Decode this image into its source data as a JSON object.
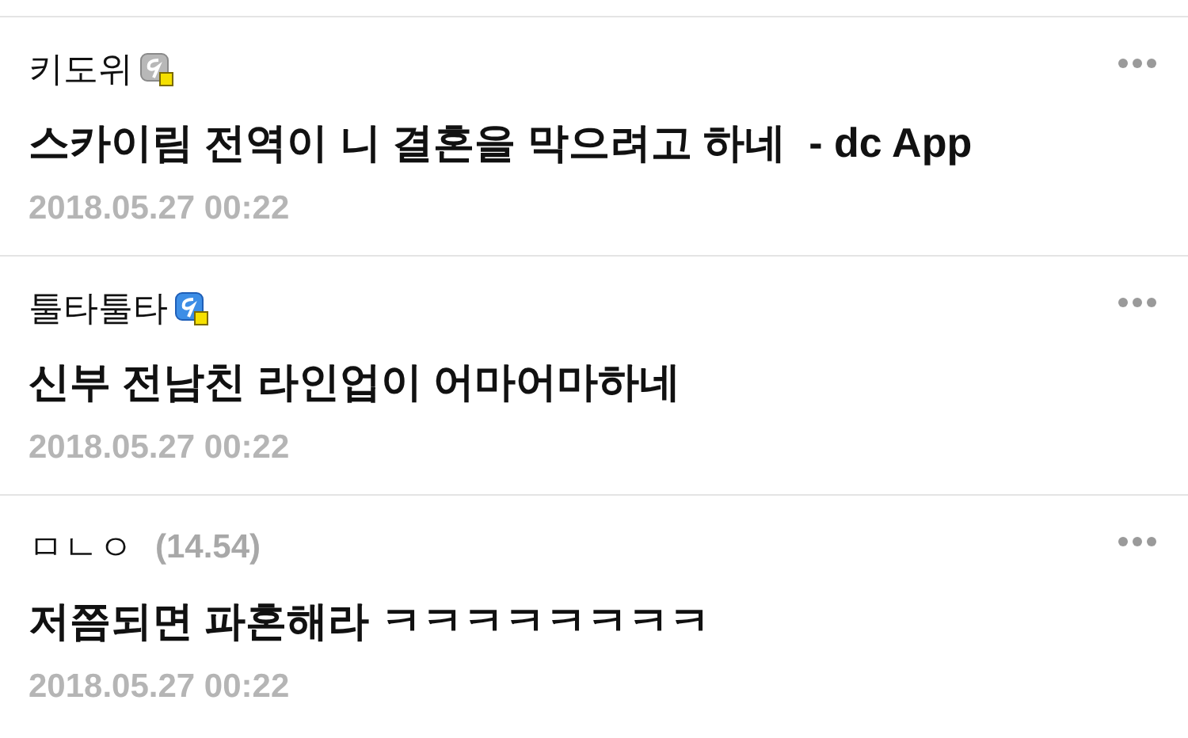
{
  "comments": [
    {
      "author": "키도위",
      "badge": {
        "kind": "gray"
      },
      "text": "스카이림 전역이 니 결혼을 막으려고 하네  - dc App",
      "date": "2018.05.27 00:22"
    },
    {
      "author": "툴타툴타",
      "badge": {
        "kind": "blue"
      },
      "text": "신부 전남친 라인업이 어마어마하네",
      "date": "2018.05.27 00:22"
    },
    {
      "author": "ㅁㄴㅇ",
      "ip": "(14.54)",
      "text": "저쯤되면 파혼해라 ㅋㅋㅋㅋㅋㅋㅋㅋ",
      "date": "2018.05.27 00:22"
    }
  ]
}
